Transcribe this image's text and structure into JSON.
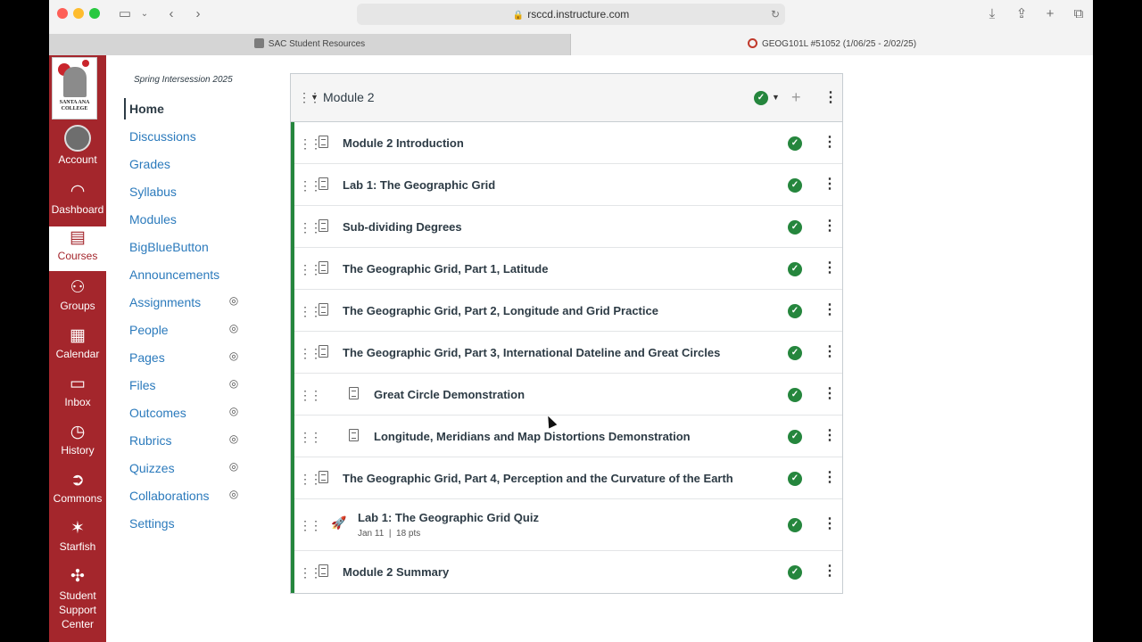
{
  "browser": {
    "url": "rsccd.instructure.com",
    "tabs": [
      {
        "label": "SAC Student Resources"
      },
      {
        "label": "GEOG101L #51052 (1/06/25 - 2/02/25)"
      }
    ]
  },
  "global_nav": {
    "logo_text": "SANTA ANA COLLEGE",
    "items": [
      {
        "label": "Account",
        "icon": "avatar"
      },
      {
        "label": "Dashboard",
        "icon": "dashboard-icon"
      },
      {
        "label": "Courses",
        "icon": "courses-icon"
      },
      {
        "label": "Groups",
        "icon": "groups-icon"
      },
      {
        "label": "Calendar",
        "icon": "calendar-icon"
      },
      {
        "label": "Inbox",
        "icon": "inbox-icon"
      },
      {
        "label": "History",
        "icon": "history-icon"
      },
      {
        "label": "Commons",
        "icon": "commons-icon"
      },
      {
        "label": "Starfish",
        "icon": "starfish-icon"
      },
      {
        "label": "Student Support Center",
        "icon": "support-icon"
      }
    ],
    "active": "Courses",
    "accent": "#a4262c"
  },
  "course_nav": {
    "term": "Spring Intersession 2025",
    "items": [
      {
        "label": "Home"
      },
      {
        "label": "Discussions"
      },
      {
        "label": "Grades"
      },
      {
        "label": "Syllabus"
      },
      {
        "label": "Modules"
      },
      {
        "label": "BigBlueButton"
      },
      {
        "label": "Announcements"
      },
      {
        "label": "Assignments",
        "hidden_icon": "eye-slash-icon"
      },
      {
        "label": "People",
        "hidden_icon": "eye-slash-icon"
      },
      {
        "label": "Pages",
        "hidden_icon": "eye-slash-icon"
      },
      {
        "label": "Files",
        "hidden_icon": "eye-slash-icon"
      },
      {
        "label": "Outcomes",
        "hidden_icon": "eye-slash-icon"
      },
      {
        "label": "Rubrics",
        "hidden_icon": "eye-slash-icon"
      },
      {
        "label": "Quizzes",
        "hidden_icon": "eye-slash-icon"
      },
      {
        "label": "Collaborations",
        "hidden_icon": "eye-slash-icon"
      },
      {
        "label": "Settings"
      }
    ]
  },
  "module": {
    "title": "Module 2",
    "published_color": "#25863d",
    "items": [
      {
        "title": "Module 2 Introduction",
        "type": "page"
      },
      {
        "title": "Lab 1: The Geographic Grid",
        "type": "page"
      },
      {
        "title": "Sub-dividing Degrees",
        "type": "page"
      },
      {
        "title": "The Geographic Grid, Part 1, Latitude",
        "type": "page"
      },
      {
        "title": "The Geographic Grid, Part 2, Longitude and Grid Practice",
        "type": "page"
      },
      {
        "title": "The Geographic Grid, Part 3, International Dateline and Great Circles",
        "type": "page"
      },
      {
        "title": "Great Circle Demonstration",
        "type": "page"
      },
      {
        "title": "Longitude, Meridians and Map Distortions Demonstration",
        "type": "page"
      },
      {
        "title": "The Geographic Grid, Part 4, Perception and the Curvature of the Earth",
        "type": "page"
      },
      {
        "title": "Lab 1: The Geographic Grid Quiz",
        "type": "quiz",
        "date": "Jan 11",
        "separator": "|",
        "points": "18 pts"
      },
      {
        "title": "Module 2 Summary",
        "type": "page"
      }
    ]
  }
}
